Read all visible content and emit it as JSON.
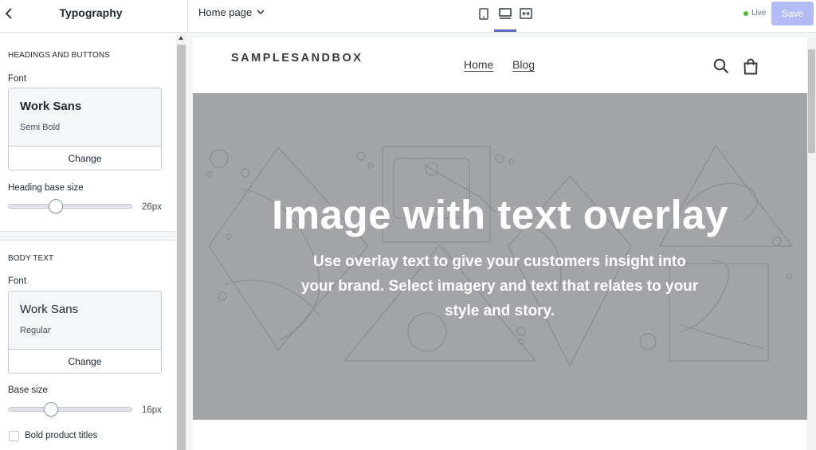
{
  "header": {
    "panel_title": "Typography",
    "page_select": "Home page",
    "status": "Live",
    "save_label": "Save",
    "devices": [
      "mobile",
      "desktop",
      "fullscreen"
    ],
    "active_device": "desktop"
  },
  "panel": {
    "headings": {
      "section_title": "HEADINGS AND BUTTONS",
      "font_label": "Font",
      "font_name": "Work Sans",
      "font_style": "Semi Bold",
      "change_label": "Change",
      "size_label": "Heading base size",
      "size_value": "26px"
    },
    "body": {
      "section_title": "BODY TEXT",
      "font_label": "Font",
      "font_name": "Work Sans",
      "font_style": "Regular",
      "change_label": "Change",
      "size_label": "Base size",
      "size_value": "16px"
    },
    "bold_titles": {
      "label": "Bold product titles",
      "checked": false
    }
  },
  "preview": {
    "logo": "SAMPLESANDBOX",
    "nav": [
      "Home",
      "Blog"
    ],
    "hero_title": "Image with text overlay",
    "hero_subtitle": "Use overlay text to give your customers insight into your brand. Select imagery and text that relates to your style and story."
  },
  "colors": {
    "accent": "#5c6ac4",
    "save_bg": "#b3bcf5",
    "live_dot": "#50b83c",
    "hero_bg": "#a3a4a7"
  }
}
